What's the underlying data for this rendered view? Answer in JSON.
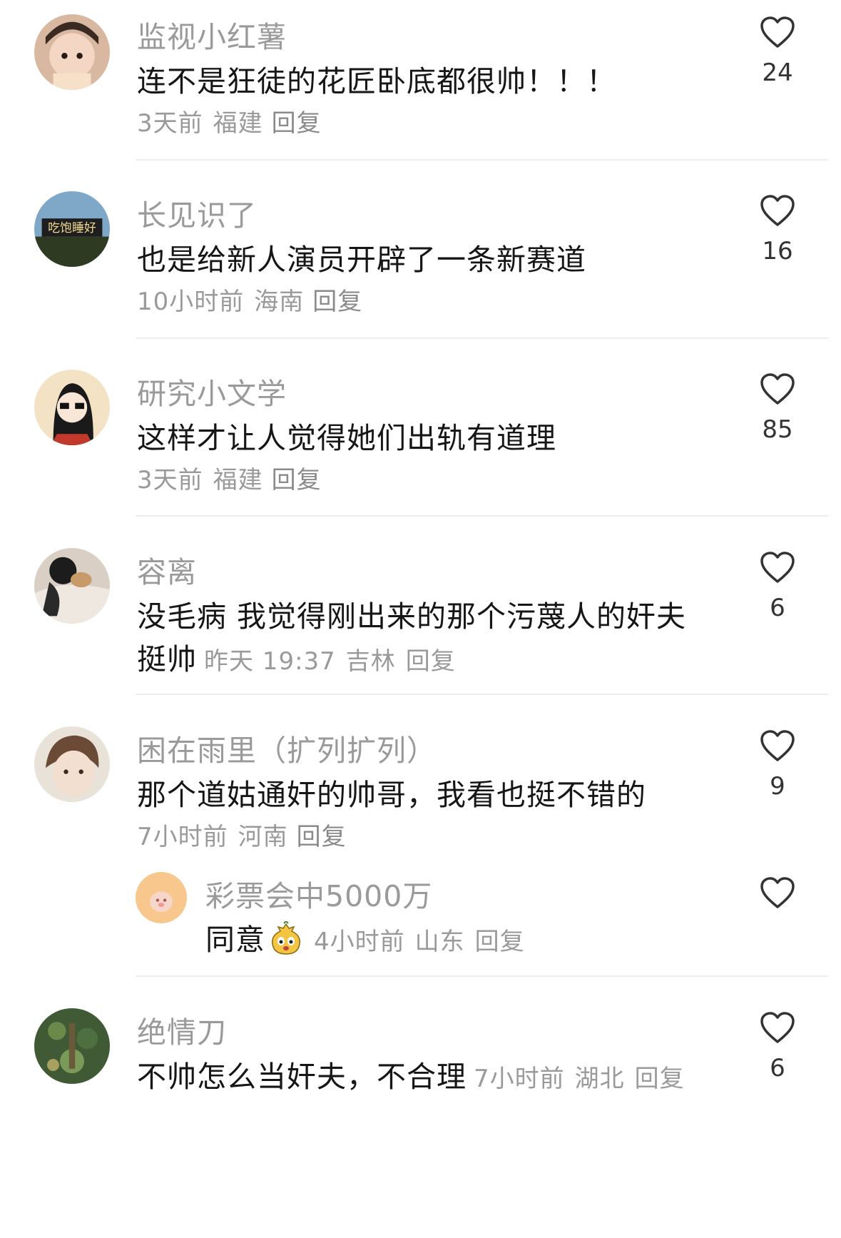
{
  "comments": [
    {
      "user": "监视小红薯",
      "text": "连不是狂徒的花匠卧底都很帅！！！",
      "time": "3天前",
      "location": "福建",
      "reply": "回复",
      "likes": "24"
    },
    {
      "user": "长见识了",
      "text": "也是给新人演员开辟了一条新赛道",
      "time": "10小时前",
      "location": "海南",
      "reply": "回复",
      "likes": "16"
    },
    {
      "user": "研究小文学",
      "text": "这样才让人觉得她们出轨有道理",
      "time": "3天前",
      "location": "福建",
      "reply": "回复",
      "likes": "85"
    },
    {
      "user": "容离",
      "text": "没毛病  我觉得刚出来的那个污蔑人的奸夫",
      "text2": "挺帅",
      "time": "昨天 19:37",
      "location": "吉林",
      "reply": "回复",
      "likes": "6"
    },
    {
      "user": "困在雨里（扩列扩列）",
      "text": "那个道姑通奸的帅哥，我看也挺不错的",
      "time": "7小时前",
      "location": "河南",
      "reply": "回复",
      "likes": "9"
    },
    {
      "user": "彩票会中5000万",
      "text": "同意",
      "time": "4小时前",
      "location": "山东",
      "reply": "回复",
      "likes": ""
    },
    {
      "user": "绝情刀",
      "text": "不帅怎么当奸夫，不合理",
      "time": "7小时前",
      "location": "湖北",
      "reply": "回复",
      "likes": "6"
    }
  ],
  "avatar_texts": {
    "banner": "吃饱睡好"
  },
  "icons": {
    "like": "heart-outline-icon",
    "emoji": "doge-emoji-icon"
  }
}
